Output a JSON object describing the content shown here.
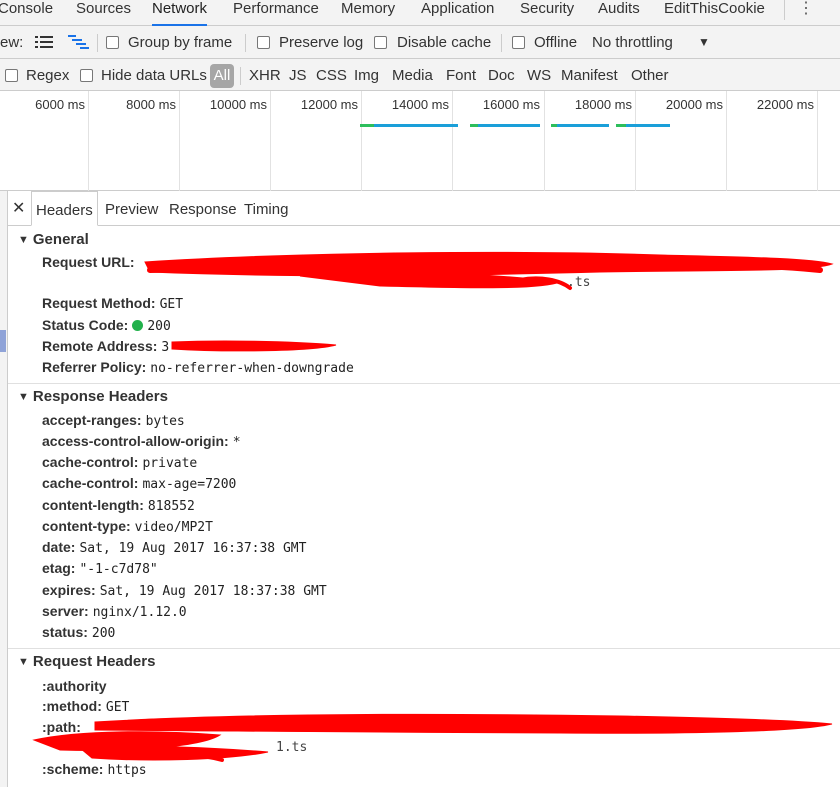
{
  "tabs": [
    {
      "label": "Console"
    },
    {
      "label": "Sources"
    },
    {
      "label": "Network"
    },
    {
      "label": "Performance"
    },
    {
      "label": "Memory"
    },
    {
      "label": "Application"
    },
    {
      "label": "Security"
    },
    {
      "label": "Audits"
    },
    {
      "label": "EditThisCookie"
    }
  ],
  "active_tab": "Network",
  "toolbar": {
    "view_label": "ew:",
    "group_by_frame": "Group by frame",
    "preserve_log": "Preserve log",
    "disable_cache": "Disable cache",
    "offline": "Offline",
    "throttling": "No throttling"
  },
  "filters": {
    "regex": "Regex",
    "hide_data_urls": "Hide data URLs",
    "types": [
      "All",
      "XHR",
      "JS",
      "CSS",
      "Img",
      "Media",
      "Font",
      "Doc",
      "WS",
      "Manifest",
      "Other"
    ]
  },
  "timeline": {
    "ticks": [
      "6000 ms",
      "8000 ms",
      "10000 ms",
      "12000 ms",
      "14000 ms",
      "16000 ms",
      "18000 ms",
      "20000 ms",
      "22000 ms"
    ]
  },
  "detail_tabs": [
    "Headers",
    "Preview",
    "Response",
    "Timing"
  ],
  "general": {
    "title": "General",
    "request_url_key": "Request URL:",
    "request_url_tail": ".ts",
    "request_method_key": "Request Method:",
    "request_method_val": "GET",
    "status_code_key": "Status Code:",
    "status_code_val": "200",
    "remote_address_key": "Remote Address:",
    "remote_address_val": "3",
    "referrer_policy_key": "Referrer Policy:",
    "referrer_policy_val": "no-referrer-when-downgrade"
  },
  "response_headers": {
    "title": "Response Headers",
    "items": [
      {
        "k": "accept-ranges:",
        "v": "bytes"
      },
      {
        "k": "access-control-allow-origin:",
        "v": "*"
      },
      {
        "k": "cache-control:",
        "v": "private"
      },
      {
        "k": "cache-control:",
        "v": "max-age=7200"
      },
      {
        "k": "content-length:",
        "v": "818552"
      },
      {
        "k": "content-type:",
        "v": "video/MP2T"
      },
      {
        "k": "date:",
        "v": "Sat, 19 Aug 2017 16:37:38 GMT"
      },
      {
        "k": "etag:",
        "v": "\"-1-c7d78\""
      },
      {
        "k": "expires:",
        "v": "Sat, 19 Aug 2017 18:37:38 GMT"
      },
      {
        "k": "server:",
        "v": "nginx/1.12.0"
      },
      {
        "k": "status:",
        "v": "200"
      }
    ]
  },
  "request_headers": {
    "title": "Request Headers",
    "authority_key": ":authority",
    "method_key": ":method:",
    "method_val": "GET",
    "path_key": ":path:",
    "path_tail": "1.ts",
    "scheme_key": ":scheme:",
    "scheme_val": "https"
  },
  "colors": {
    "accent": "#1a73e8",
    "redaction": "#ff0000",
    "status_ok": "#22b14c",
    "waterfall_wait": "#2dbe5c",
    "waterfall_download": "#1a9fd9"
  }
}
